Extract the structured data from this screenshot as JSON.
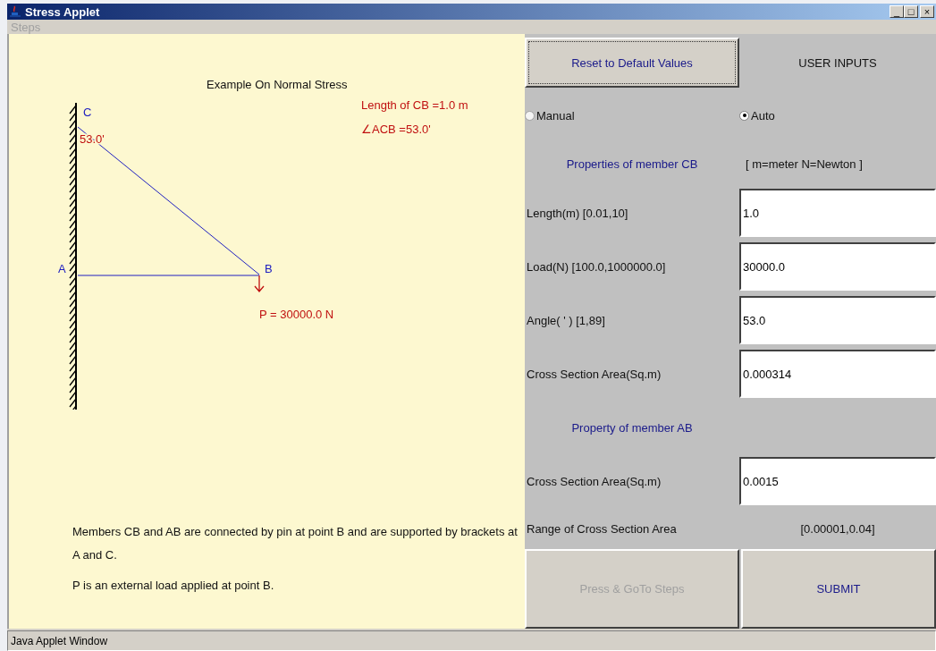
{
  "window": {
    "title": "Stress Applet",
    "controls": [
      "_",
      "□",
      "×"
    ]
  },
  "menu": [
    {
      "label": "Steps",
      "disabled": true
    }
  ],
  "diagram": {
    "title": "Example On Normal Stress",
    "length_label": "Length of CB =1.0 m",
    "angle_label": "∠ACB =53.0'",
    "angle_value": "53.0'",
    "points": [
      "C",
      "A",
      "B"
    ],
    "load_label": "P = 30000.0 N"
  },
  "description": [
    "Members CB and AB are connected by pin at point B and are supported by brackets at A and C.",
    "P is an external load applied at point B."
  ],
  "inputs": {
    "reset_button": "Reset to Default Values",
    "heading": "USER INPUTS",
    "modes": [
      {
        "label": "Manual",
        "selected": false
      },
      {
        "label": "Auto",
        "selected": true
      }
    ],
    "cb_header": "Properties of member CB",
    "units": "[ m=meter   N=Newton ]",
    "cb_fields": [
      {
        "label": "Length(m) [0.01,10]",
        "value": "1.0"
      },
      {
        "label": "Load(N) [100.0,1000000.0]",
        "value": "30000.0"
      },
      {
        "label": "Angle( ' ) [1,89]",
        "value": "53.0"
      },
      {
        "label": "Cross Section Area(Sq.m)",
        "value": "0.000314"
      }
    ],
    "ab_header": "Property of member AB",
    "ab_fields": [
      {
        "label": "Cross Section Area(Sq.m)",
        "value": "0.0015"
      }
    ],
    "range_label": "Range of Cross Section Area",
    "range_value": "[0.00001,0.04]",
    "buttons": [
      {
        "label": "Press & GoTo Steps",
        "disabled": true
      },
      {
        "label": "SUBMIT",
        "disabled": false
      }
    ]
  },
  "status_bar": "Java Applet Window"
}
